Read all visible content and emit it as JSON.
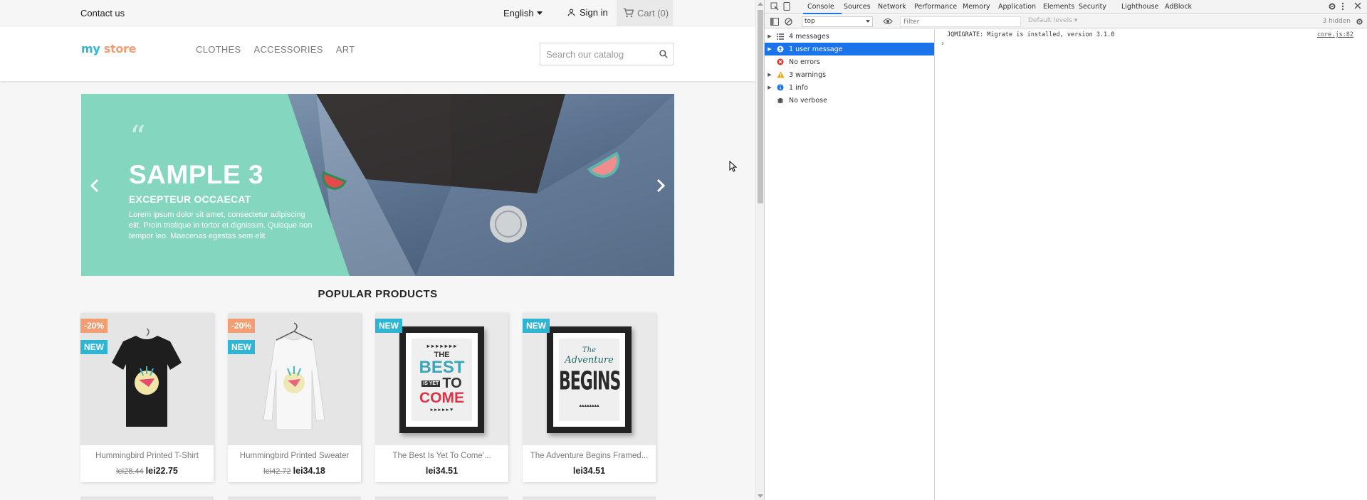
{
  "store": {
    "topbar": {
      "contact": "Contact us",
      "language": "English",
      "signin": "Sign in",
      "cart": "Cart (0)"
    },
    "logo": {
      "part1": "my",
      "part2": "store"
    },
    "nav": [
      "CLOTHES",
      "ACCESSORIES",
      "ART"
    ],
    "search": {
      "placeholder": "Search our catalog"
    },
    "slider": {
      "quote_mark": "“",
      "title": "SAMPLE 3",
      "subtitle": "EXCEPTEUR OCCAECAT",
      "description": "Lorem ipsum dolor sit amet, consectetur adipiscing elit. Proin tristique in tortor et dignissim. Quisque non tempor leo. Maecenas egestas sem elit"
    },
    "popular_title": "POPULAR PRODUCTS",
    "products": [
      {
        "name": "Hummingbird Printed T-Shirt",
        "old_price": "lei28.44",
        "price": "lei22.75",
        "discount": "-20%",
        "flag": "NEW"
      },
      {
        "name": "Hummingbird Printed Sweater",
        "old_price": "lei42.72",
        "price": "lei34.18",
        "discount": "-20%",
        "flag": "NEW"
      },
      {
        "name": "The Best Is Yet To Come'...",
        "old_price": "",
        "price": "lei34.51",
        "discount": "",
        "flag": "NEW"
      },
      {
        "name": "The Adventure Begins Framed...",
        "old_price": "",
        "price": "lei34.51",
        "discount": "",
        "flag": "NEW"
      }
    ],
    "poster1": {
      "l1": "THE",
      "l2": "BEST",
      "l3": "IS YET",
      "l4": "TO",
      "l5": "COME"
    },
    "poster2": {
      "l1": "The",
      "l2": "Adventure",
      "l3": "BEGINS"
    },
    "colors": {
      "accent": "#2fb5d2",
      "discount": "#f39d72",
      "slider_mint": "#84d6be"
    }
  },
  "devtools": {
    "tabs": [
      "Console",
      "Sources",
      "Network",
      "Performance",
      "Memory",
      "Application",
      "Elements",
      "Security",
      "Lighthouse",
      "AdBlock"
    ],
    "context": "top",
    "filter_placeholder": "Filter",
    "levels": "Default levels ▾",
    "hidden_count": "3 hidden",
    "sidebar": [
      {
        "label": "4 messages",
        "icon": "list-icon",
        "expandable": true,
        "selected": false
      },
      {
        "label": "1 user message",
        "icon": "user-icon",
        "expandable": true,
        "selected": true
      },
      {
        "label": "No errors",
        "icon": "error-icon",
        "expandable": false,
        "selected": false
      },
      {
        "label": "3 warnings",
        "icon": "warning-icon",
        "expandable": true,
        "selected": false
      },
      {
        "label": "1 info",
        "icon": "info-icon",
        "expandable": true,
        "selected": false
      },
      {
        "label": "No verbose",
        "icon": "bug-icon",
        "expandable": false,
        "selected": false
      }
    ],
    "console_message": "JQMIGRATE: Migrate is installed, version 3.1.0",
    "console_source": "core.js:82",
    "prompt": "›"
  }
}
